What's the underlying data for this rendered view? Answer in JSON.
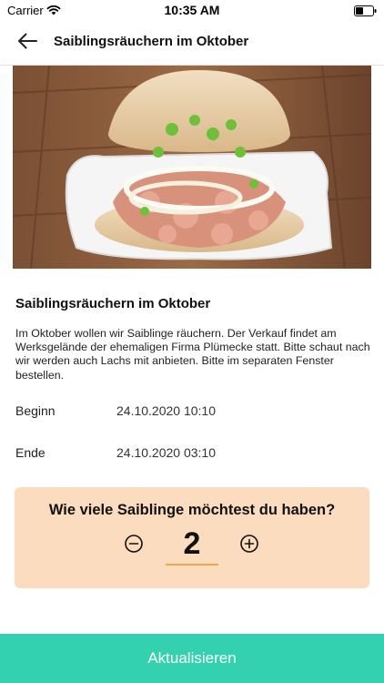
{
  "status_bar": {
    "carrier": "Carrier",
    "time": "10:35 AM",
    "wifi_icon": "wifi-icon",
    "battery_icon": "battery-icon"
  },
  "nav": {
    "back_icon": "arrow-left-icon",
    "title": "Saiblingsräuchern im Oktober"
  },
  "event": {
    "image": "fish-sandwich-photo",
    "title": "Saiblingsräuchern im Oktober",
    "description": "Im Oktober wollen wir Saiblinge räuchern. Der Verkauf findet am Werksgelände der ehemaligen Firma Plümecke statt. Bitte schaut nach wir werden auch Lachs mit anbieten. Bitte im separaten Fenster bestellen.",
    "begin_label": "Beginn",
    "begin_value": "24.10.2020 10:10",
    "end_label": "Ende",
    "end_value": "24.10.2020 03:10"
  },
  "quantity": {
    "question": "Wie viele Saiblinge möchtest du haben?",
    "value": "2",
    "minus_icon": "minus-circle-icon",
    "plus_icon": "plus-circle-icon",
    "card_color": "#fbdcbf",
    "underline_color": "#f0a54d"
  },
  "actions": {
    "update_label": "Aktualisieren",
    "update_color": "#33d1b0"
  }
}
